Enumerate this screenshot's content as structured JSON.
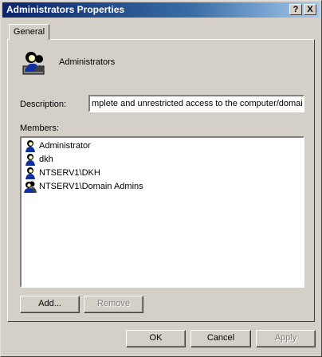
{
  "window": {
    "title": "Administrators Properties",
    "help_button": "?",
    "close_button": "X"
  },
  "tabs": [
    {
      "label": "General"
    }
  ],
  "group": {
    "icon": "group-icon",
    "name": "Administrators"
  },
  "description": {
    "label": "Description:",
    "value": "mplete and unrestricted access to the computer/domain"
  },
  "members": {
    "label": "Members:",
    "items": [
      {
        "name": "Administrator",
        "icon": "user-icon"
      },
      {
        "name": "dkh",
        "icon": "user-icon"
      },
      {
        "name": "NTSERV1\\DKH",
        "icon": "user-icon"
      },
      {
        "name": "NTSERV1\\Domain Admins",
        "icon": "group-icon"
      }
    ]
  },
  "buttons": {
    "add": "Add...",
    "remove": "Remove",
    "ok": "OK",
    "cancel": "Cancel",
    "apply": "Apply"
  }
}
